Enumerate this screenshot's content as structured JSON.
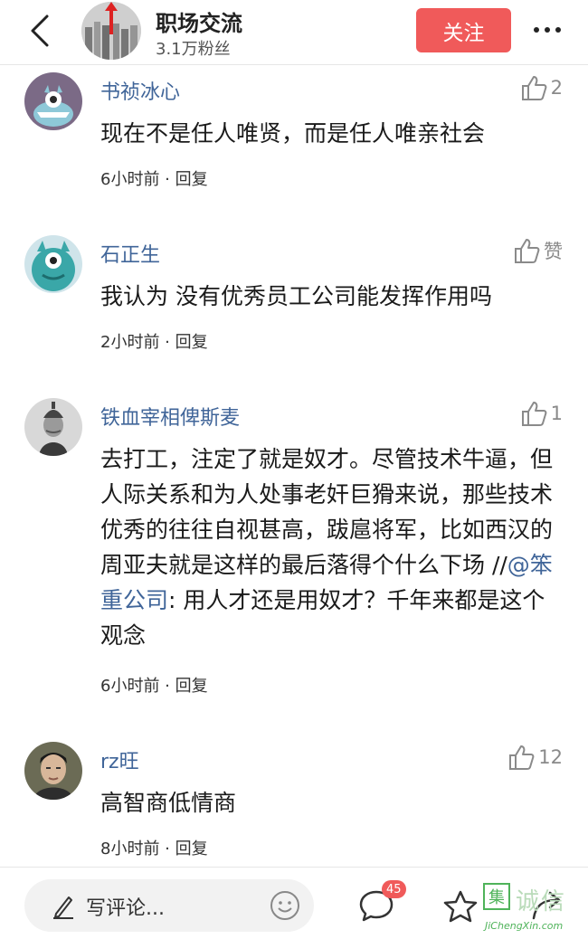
{
  "header": {
    "account_name": "职场交流",
    "fans": "3.1万粉丝",
    "follow_label": "关注"
  },
  "comments": [
    {
      "username": "书祯冰心",
      "likes": "2",
      "text": "现在不是任人唯贤，而是任人唯亲社会",
      "time": "6小时前 · 回复"
    },
    {
      "username": "石正生",
      "likes": "赞",
      "text": "我认为 没有优秀员工公司能发挥作用吗",
      "time": "2小时前 · 回复"
    },
    {
      "username": "铁血宰相俾斯麦",
      "likes": "1",
      "text_before": "去打工，注定了就是奴才。尽管技术牛逼，但人际关系和为人处事老奸巨猾来说，那些技术优秀的往往自视甚高，跋扈将军，比如西汉的周亚夫就是这样的最后落得个什么下场 //",
      "mention": "@笨重公司",
      "text_after": ": 用人才还是用奴才？千年来都是这个观念",
      "time": "6小时前 · 回复"
    },
    {
      "username": "rz旺",
      "likes": "12",
      "text": "高智商低情商",
      "time": "8小时前 · 回复"
    }
  ],
  "bottom_bar": {
    "input_placeholder": "写评论...",
    "message_count": "45"
  },
  "watermark": {
    "box_char": "集",
    "chars": "诚信",
    "url": "JiChengXin.com"
  },
  "colors": {
    "accent": "#f05a5a",
    "username": "#406599",
    "watermark": "#4fb35a"
  }
}
